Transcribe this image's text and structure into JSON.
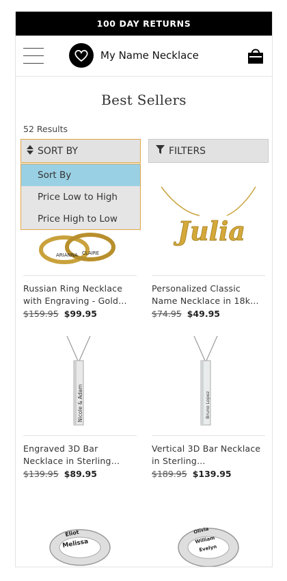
{
  "promo": {
    "text": "100 DAY RETURNS"
  },
  "header": {
    "brand": "My Name Necklace"
  },
  "page": {
    "title": "Best Sellers",
    "results": "52 Results"
  },
  "toolbar": {
    "sort_label": "SORT BY",
    "filter_label": "FILTERS"
  },
  "sort_options": [
    {
      "label": "Sort By",
      "selected": true
    },
    {
      "label": "Price Low to High",
      "selected": false
    },
    {
      "label": "Price High to Low",
      "selected": false
    }
  ],
  "products": [
    {
      "name": "Russian Ring Necklace with Engraving - Gold…",
      "old_price": "$159.95",
      "price": "$99.95"
    },
    {
      "name": "Personalized Classic Name Necklace in 18k…",
      "old_price": "$74.95",
      "price": "$49.95"
    },
    {
      "name": "Engraved 3D Bar Necklace in Sterling…",
      "old_price": "$139.95",
      "price": "$89.95"
    },
    {
      "name": "Vertical 3D Bar Necklace in Sterling…",
      "old_price": "$189.95",
      "price": "$139.95"
    }
  ],
  "images": {
    "ring_names": [
      "ARIANNA",
      "CLAIRE"
    ],
    "script_name": "Julia",
    "bar_text_1": "Nicole & Adam",
    "bar_text_2": "Bruno Lopez",
    "bottom_ring_1": [
      "Eliot",
      "Melissa"
    ],
    "bottom_ring_2": [
      "Olivia",
      "William",
      "Evelyn"
    ]
  },
  "colors": {
    "accent_border": "#e0a545",
    "selected_option": "#9ad0e3",
    "promo_bg": "#000000"
  }
}
